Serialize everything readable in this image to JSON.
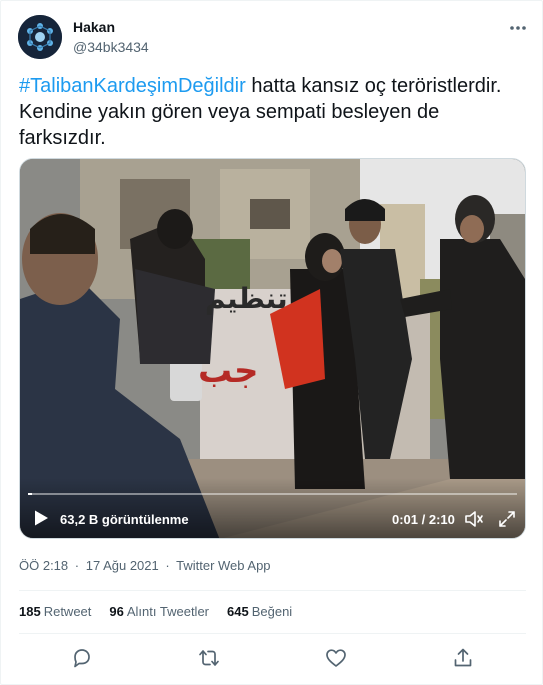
{
  "user": {
    "display_name": "Hakan",
    "handle": "@34bk3434"
  },
  "tweet": {
    "hashtag": "#TalibanKardeşimDeğildir",
    "text_line1_rest": " hatta kansız oç teröristlerdir.",
    "text_line2": "Kendine yakın gören veya sempati besleyen de",
    "text_line3": "farksızdır."
  },
  "video": {
    "views": "63,2 B görüntülenme",
    "time": "0:01 / 2:10",
    "progress": 0.008,
    "wall_text_top": "تنظيم",
    "wall_text_bottom": "جب"
  },
  "meta": {
    "time": "ÖÖ 2:18",
    "separator": "·",
    "date": "17 Ağu 2021",
    "source": "Twitter Web App"
  },
  "stats": {
    "retweets_count": "185",
    "retweets_label": "Retweet",
    "quotes_count": "96",
    "quotes_label": "Alıntı Tweetler",
    "likes_count": "645",
    "likes_label": "Beğeni"
  },
  "colors": {
    "accent": "#1d9bf0",
    "secondary_text": "#536471",
    "border": "#eff3f4"
  },
  "icons": {
    "more": "more-dots-icon",
    "reply": "reply-icon",
    "retweet": "retweet-icon",
    "like": "like-icon",
    "share": "share-icon",
    "play": "play-icon",
    "volume": "volume-icon",
    "fullscreen": "fullscreen-icon"
  }
}
